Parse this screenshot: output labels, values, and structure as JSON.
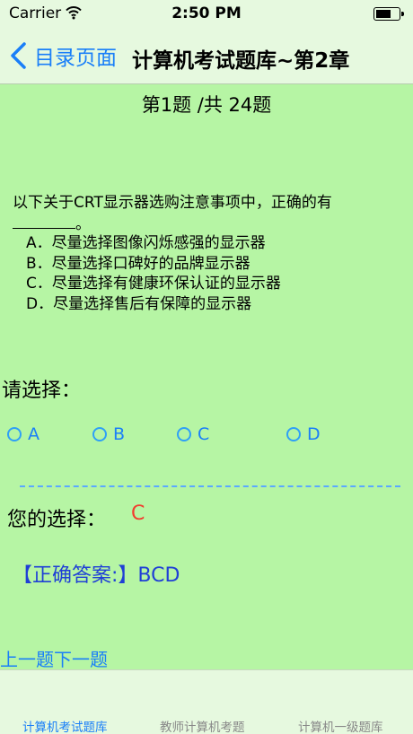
{
  "status_bar": {
    "carrier": "Carrier",
    "time": "2:50 PM",
    "battery_level": 0.7
  },
  "nav": {
    "back_label": "目录页面",
    "title": "计算机考试题库~第2章"
  },
  "question": {
    "number_text": "第1题 /共 24题",
    "text": "以下关于CRT显示器选购注意事项中，正确的有",
    "text_end": "。",
    "options": [
      "A．尽量选择图像闪烁感强的显示器",
      "B．尽量选择口碑好的品牌显示器",
      "C．尽量选择有健康环保认证的显示器",
      "D．尽量选择售后有保障的显示器"
    ]
  },
  "choose": {
    "label": "请选择：",
    "choices": [
      "A",
      "B",
      "C",
      "D"
    ]
  },
  "result": {
    "your_label": "您的选择：",
    "your_value": "C",
    "answer_text": "【正确答案:】BCD"
  },
  "navigation": {
    "prev": "上一题",
    "next": "下一题"
  },
  "tabs": [
    "计算机考试题库",
    "教师计算机考题",
    "计算机一级题库"
  ],
  "colors": {
    "background": "#b6f5a4",
    "accent": "#1a7ff8",
    "wrong": "#f23c2e",
    "answer": "#1f3fd6"
  }
}
